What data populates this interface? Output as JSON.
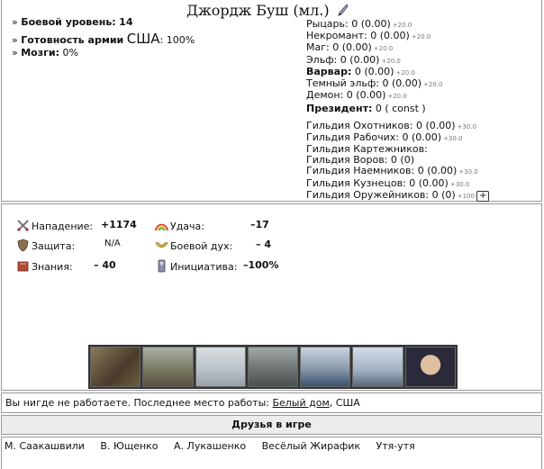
{
  "character": {
    "name": "Джордж Буш",
    "suffix": "(мл.)",
    "combat_level_label": "Боевой уровень:",
    "combat_level": "14",
    "readiness_label": "Готовность армии",
    "readiness_country": "США",
    "readiness_value": ": 100%",
    "brains_label": "Мозги:",
    "brains_value": "0%"
  },
  "skills": [
    {
      "text": "Рыцарь: 0 (0.00)",
      "bonus": "+20.0",
      "bold": false
    },
    {
      "text": "Некромант: 0 (0.00)",
      "bonus": "+20.0",
      "bold": false
    },
    {
      "text": "Маг: 0 (0.00)",
      "bonus": "+20.0",
      "bold": false
    },
    {
      "text": "Эльф: 0 (0.00)",
      "bonus": "+20.0",
      "bold": false
    },
    {
      "label": "Варвар:",
      "text": " 0 (0.00)",
      "bonus": "+20.0",
      "bold": true
    },
    {
      "text": "Темный эльф: 0 (0.00)",
      "bonus": "+20.0",
      "bold": false
    },
    {
      "text": "Демон: 0 (0.00)",
      "bonus": "+20.0",
      "bold": false
    },
    {
      "label": "Президент:",
      "text": " 0 ( const )",
      "bonus": "",
      "bold": true
    }
  ],
  "guilds": [
    {
      "text": "Гильдия Охотников: 0 (0.00)",
      "bonus": "+30.0"
    },
    {
      "text": "Гильдия Рабочих: 0 (0.00)",
      "bonus": "+30.0"
    },
    {
      "text": "Гильдия Картежников:",
      "bonus": ""
    },
    {
      "text": "Гильдия Воров: 0 (0)",
      "bonus": ""
    },
    {
      "text": "Гильдия Наемников: 0 (0.00)",
      "bonus": "+30.0"
    },
    {
      "text": "Гильдия Кузнецов: 0 (0.00)",
      "bonus": "+30.0"
    },
    {
      "text": "Гильдия Оружейников: 0 (0)",
      "bonus": "+100",
      "plus": "+"
    }
  ],
  "stats": {
    "attack_label": "Нападение:",
    "attack": "+1174",
    "defense_label": "Защита:",
    "defense": "N/A",
    "knowledge_label": "Знания:",
    "knowledge": "– 40",
    "luck_label": "Удача:",
    "luck": "–17",
    "morale_label": "Боевой дух:",
    "morale": "– 4",
    "initiative_label": "Инициатива:",
    "initiative": "–100%"
  },
  "work": {
    "text": "Вы нигде не работаете. Последнее место работы: ",
    "link": "Белый дом",
    "suffix": ", США"
  },
  "friends": {
    "header": "Друзья в игре",
    "list": [
      "М. Саакашвили",
      "В. Ющенко",
      "А. Лукашенко",
      "Весёлый Жирафик",
      "Утя-утя"
    ]
  },
  "colors": {
    "border": "#999999",
    "header_bg": "#ececec",
    "bonus": "#777777"
  }
}
